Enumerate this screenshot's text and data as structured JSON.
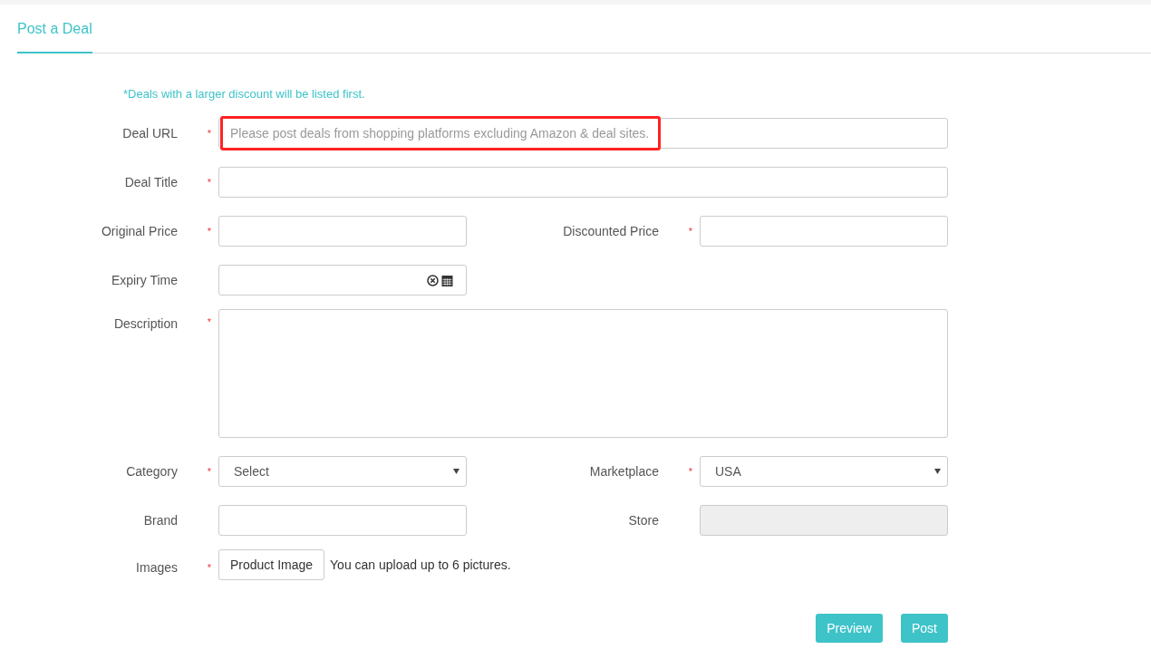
{
  "tabs": [
    {
      "label": "Post a Deal",
      "selected": true
    }
  ],
  "notice": "*Deals with a larger discount will be listed first.",
  "rows": [
    {
      "fields": [
        {
          "kind": "text",
          "label": "Deal URL",
          "required_mark": "*",
          "placeholder": "Please post deals from shopping platforms excluding Amazon & deal sites.",
          "highlighted": true
        }
      ]
    },
    {
      "fields": [
        {
          "kind": "text",
          "label": "Deal Title",
          "required_mark": "*"
        }
      ]
    },
    {
      "fields": [
        {
          "kind": "text",
          "label": "Original Price",
          "required_mark": "*"
        },
        {
          "kind": "text",
          "label": "Discounted Price",
          "required_mark": "*"
        }
      ]
    },
    {
      "fields": [
        {
          "kind": "date",
          "label": "Expiry Time"
        }
      ]
    },
    {
      "fields": [
        {
          "kind": "textarea",
          "label": "Description",
          "required_mark": "*"
        }
      ]
    },
    {
      "fields": [
        {
          "kind": "select",
          "label": "Category",
          "required_mark": "*",
          "value": "Select"
        },
        {
          "kind": "select",
          "label": "Marketplace",
          "required_mark": "*",
          "value": "USA"
        }
      ]
    },
    {
      "fields": [
        {
          "kind": "text",
          "label": "Brand"
        },
        {
          "kind": "text",
          "label": "Store",
          "disabled": true
        }
      ]
    },
    {
      "fields": [
        {
          "kind": "upload",
          "label": "Images",
          "required_mark": "*",
          "button": "Product Image",
          "note": "You can upload up to 6 pictures."
        }
      ]
    }
  ],
  "buttons": [
    "Preview",
    "Post"
  ]
}
